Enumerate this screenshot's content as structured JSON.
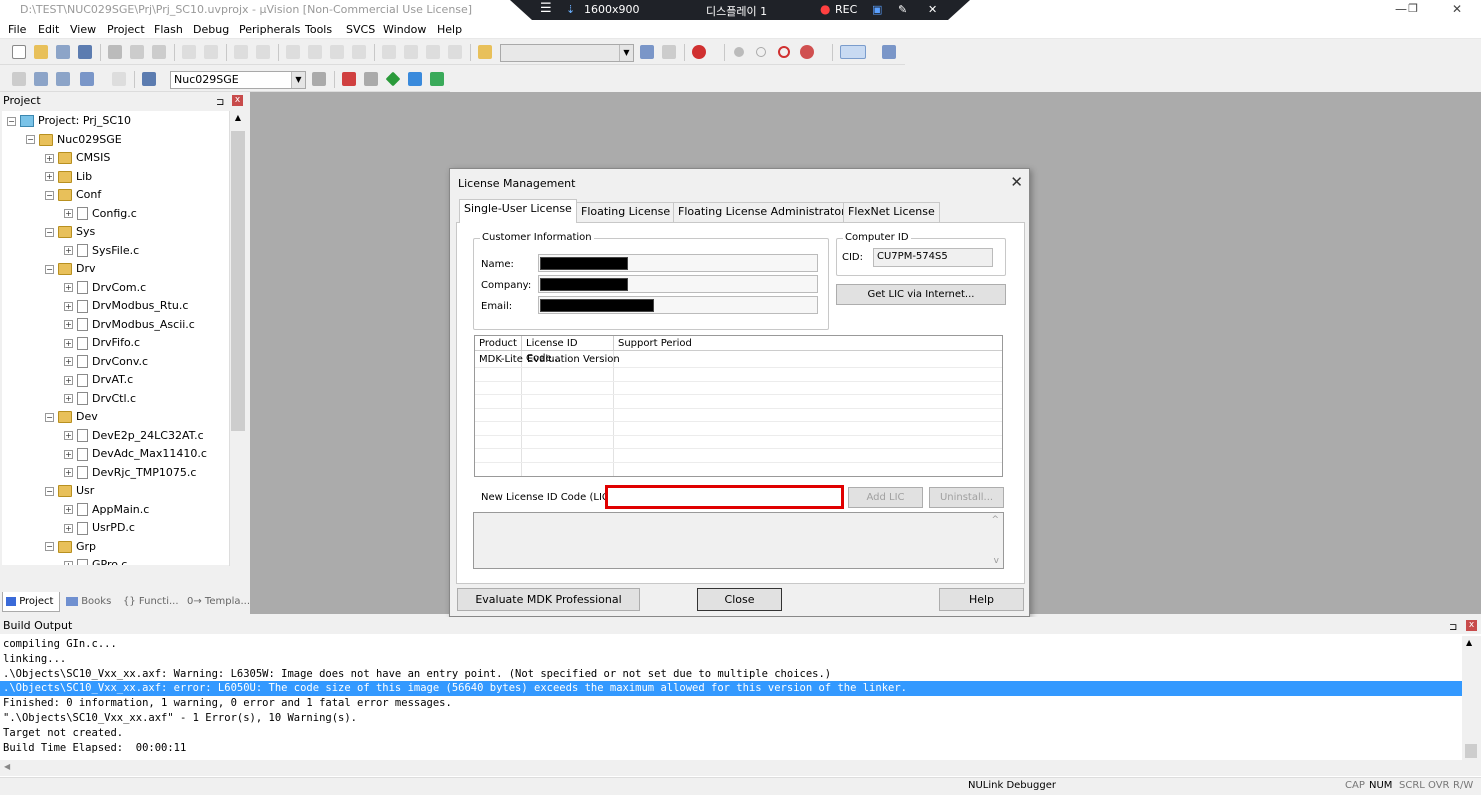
{
  "window": {
    "title": "D:\\TEST\\NUC029SGE\\Prj\\Prj_SC10.uvprojx - µVision  [Non-Commercial Use License]",
    "minimize": "—",
    "restore": "❐",
    "close": "✕"
  },
  "recorder": {
    "resolution": "1600x900",
    "display": "디스플레이 1",
    "rec": "REC"
  },
  "menu": [
    "File",
    "Edit",
    "View",
    "Project",
    "Flash",
    "Debug",
    "Peripherals",
    "Tools",
    "SVCS",
    "Window",
    "Help"
  ],
  "toolbar": {
    "target_combo": "Nuc029SGE"
  },
  "project_panel": {
    "title": "Project",
    "pin": "⊐",
    "close": "x",
    "tree": [
      {
        "label": "Project: Prj_SC10",
        "level": 0,
        "type": "project",
        "expander": "⊟"
      },
      {
        "label": "Nuc029SGE",
        "level": 1,
        "type": "folder",
        "expander": "⊟"
      },
      {
        "label": "CMSIS",
        "level": 2,
        "type": "folder",
        "expander": "⊞"
      },
      {
        "label": "Lib",
        "level": 2,
        "type": "folder",
        "expander": "⊞"
      },
      {
        "label": "Conf",
        "level": 2,
        "type": "folder",
        "expander": "⊟"
      },
      {
        "label": "Config.c",
        "level": 3,
        "type": "file",
        "expander": "⊞"
      },
      {
        "label": "Sys",
        "level": 2,
        "type": "folder",
        "expander": "⊟"
      },
      {
        "label": "SysFile.c",
        "level": 3,
        "type": "file",
        "expander": "⊞"
      },
      {
        "label": "Drv",
        "level": 2,
        "type": "folder",
        "expander": "⊟"
      },
      {
        "label": "DrvCom.c",
        "level": 3,
        "type": "file",
        "expander": "⊞"
      },
      {
        "label": "DrvModbus_Rtu.c",
        "level": 3,
        "type": "file",
        "expander": "⊞"
      },
      {
        "label": "DrvModbus_Ascii.c",
        "level": 3,
        "type": "file",
        "expander": "⊞"
      },
      {
        "label": "DrvFifo.c",
        "level": 3,
        "type": "file",
        "expander": "⊞"
      },
      {
        "label": "DrvConv.c",
        "level": 3,
        "type": "file",
        "expander": "⊞"
      },
      {
        "label": "DrvAT.c",
        "level": 3,
        "type": "file",
        "expander": "⊞"
      },
      {
        "label": "DrvCtl.c",
        "level": 3,
        "type": "file",
        "expander": "⊞"
      },
      {
        "label": "Dev",
        "level": 2,
        "type": "folder",
        "expander": "⊟"
      },
      {
        "label": "DevE2p_24LC32AT.c",
        "level": 3,
        "type": "file",
        "expander": "⊞"
      },
      {
        "label": "DevAdc_Max11410.c",
        "level": 3,
        "type": "file",
        "expander": "⊞"
      },
      {
        "label": "DevRjc_TMP1075.c",
        "level": 3,
        "type": "file",
        "expander": "⊞"
      },
      {
        "label": "Usr",
        "level": 2,
        "type": "folder",
        "expander": "⊟"
      },
      {
        "label": "AppMain.c",
        "level": 3,
        "type": "file",
        "expander": "⊞"
      },
      {
        "label": "UsrPD.c",
        "level": 3,
        "type": "file",
        "expander": "⊞"
      },
      {
        "label": "Grp",
        "level": 2,
        "type": "folder",
        "expander": "⊟"
      },
      {
        "label": "GPro.c",
        "level": 3,
        "type": "file",
        "expander": "⊞"
      }
    ],
    "tabs": [
      "Project",
      "Books",
      "{} Functi...",
      "0→ Templa..."
    ]
  },
  "dialog": {
    "title": "License Management",
    "close": "✕",
    "tabs": [
      "Single-User License",
      "Floating License",
      "Floating License Administrator",
      "FlexNet License"
    ],
    "customer_info_label": "Customer Information",
    "name_label": "Name:",
    "company_label": "Company:",
    "email_label": "Email:",
    "computer_id_label": "Computer ID",
    "cid_label": "CID:",
    "cid_value": "CU7PM-574S5",
    "get_lic_button": "Get LIC via Internet...",
    "list_headers": [
      "Product",
      "License ID Code...",
      "Support Period"
    ],
    "list_rows": [
      {
        "product": "MDK-Lite",
        "code": "Evaluation Version",
        "period": ""
      }
    ],
    "new_lic_label": "New License ID Code (LIC):",
    "new_lic_value": "",
    "add_lic_button": "Add LIC",
    "uninstall_button": "Uninstall...",
    "evaluate_button": "Evaluate MDK Professional",
    "close_button": "Close",
    "help_button": "Help",
    "highlight_color": "#e00000"
  },
  "build_output": {
    "title": "Build Output",
    "lines": [
      "compiling GIn.c...",
      "linking...",
      ".\\Objects\\SC10_Vxx_xx.axf: Warning: L6305W: Image does not have an entry point. (Not specified or not set due to multiple choices.)",
      ".\\Objects\\SC10_Vxx_xx.axf: error: L6050U: The code size of this image (56640 bytes) exceeds the maximum allowed for this version of the linker.",
      "Finished: 0 information, 1 warning, 0 error and 1 fatal error messages.",
      "\".\\Objects\\SC10_Vxx_xx.axf\" - 1 Error(s), 10 Warning(s).",
      "Target not created.",
      "Build Time Elapsed:  00:00:11"
    ],
    "highlight_line": 3,
    "highlight_color": "#3399ff"
  },
  "status": {
    "debugger": "NULink Debugger",
    "indicators": [
      "CAP",
      "NUM",
      "SCRL",
      "OVR",
      "R/W"
    ]
  }
}
